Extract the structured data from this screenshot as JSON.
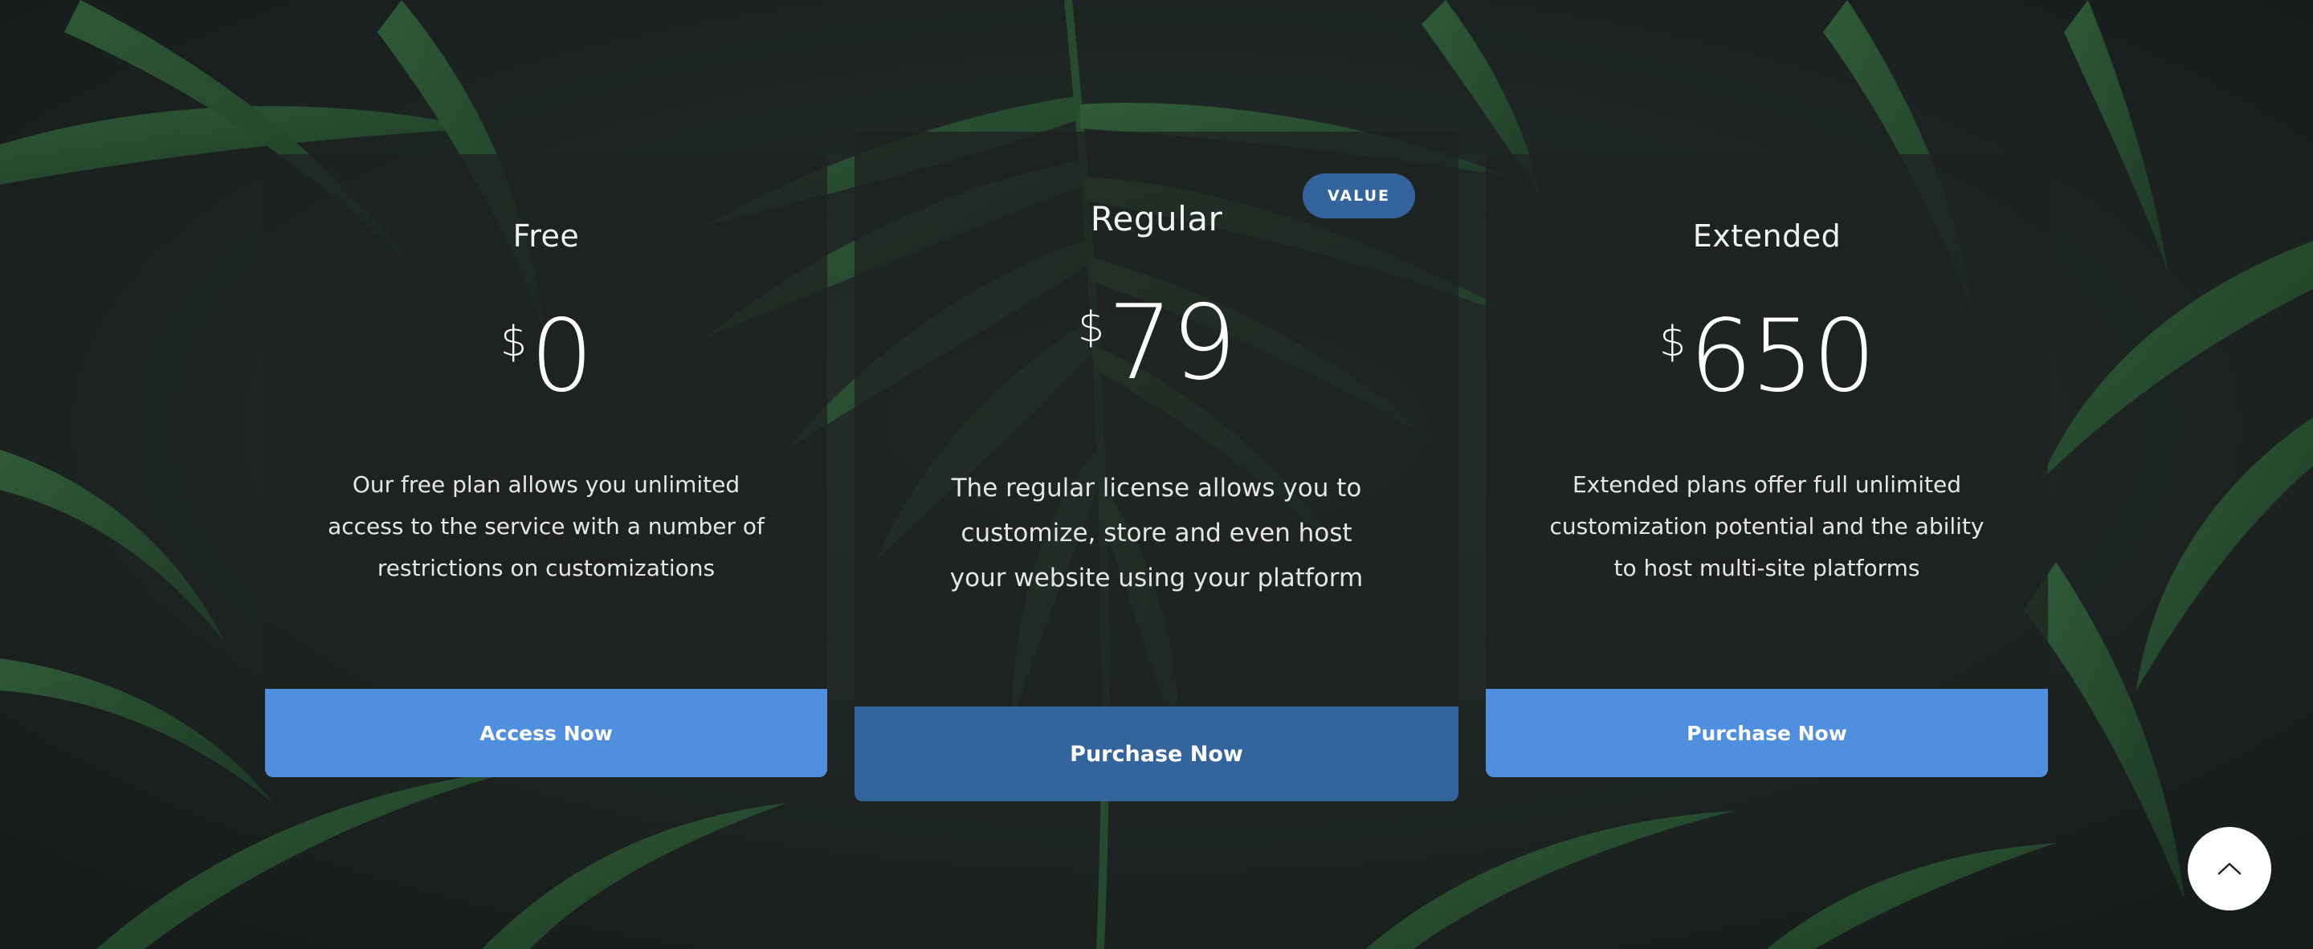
{
  "plans": [
    {
      "title": "Free",
      "currency": "$",
      "price": "0",
      "description": "Our free plan allows you unlimited access to the service with a number of restrictions on customizations",
      "cta_label": "Access Now"
    },
    {
      "title": "Regular",
      "badge": "VALUE",
      "currency": "$",
      "price": "79",
      "description": "The regular license allows you to customize, store and even host your website using your platform",
      "cta_label": "Purchase Now"
    },
    {
      "title": "Extended",
      "currency": "$",
      "price": "650",
      "description": "Extended plans offer full unlimited customization potential and the ability to host multi-site platforms",
      "cta_label": "Purchase Now"
    }
  ],
  "scroll_top": {
    "icon": "chevron-up-icon"
  },
  "colors": {
    "background": "#1f2625",
    "primary_button": "#4f8fdd",
    "featured_button": "#34649c",
    "badge": "#34649c",
    "leaf": "#2f6b3a"
  },
  "background_image": {
    "icon": "palm-leaves-image"
  }
}
